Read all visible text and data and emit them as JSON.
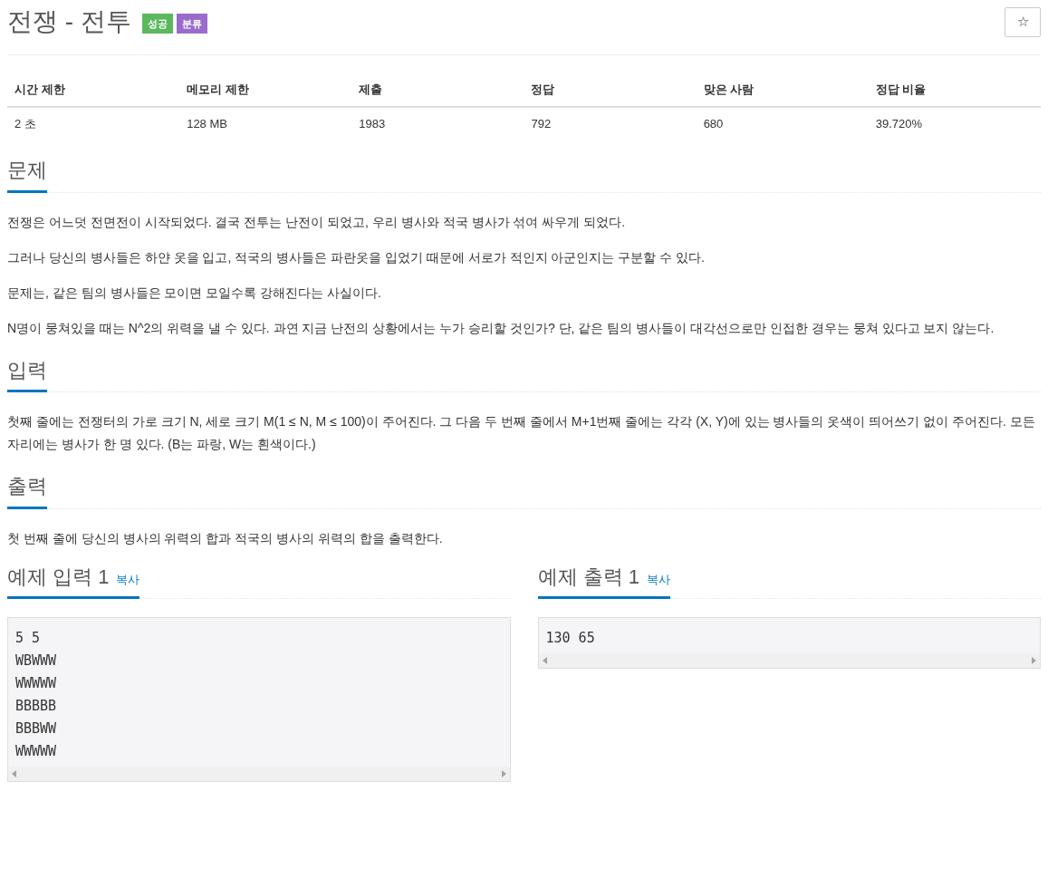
{
  "title": "전쟁 - 전투",
  "badges": [
    {
      "label": "성공",
      "color": "#5cb85c"
    },
    {
      "label": "분류",
      "color": "#9b6bcc"
    }
  ],
  "star_button": "☆",
  "stats": {
    "columns": [
      "시간 제한",
      "메모리 제한",
      "제출",
      "정답",
      "맞은 사람",
      "정답 비율"
    ],
    "row": [
      "2 초",
      "128 MB",
      "1983",
      "792",
      "680",
      "39.720%"
    ]
  },
  "sections": [
    {
      "heading": "문제",
      "paragraphs": [
        "전쟁은 어느덧 전면전이 시작되었다. 결국 전투는 난전이 되었고, 우리 병사와 적국 병사가 섞여 싸우게 되었다.",
        "그러나 당신의 병사들은 하얀 옷을 입고, 적국의 병사들은 파란옷을 입었기 때문에 서로가 적인지 아군인지는 구분할 수 있다.",
        "문제는, 같은 팀의 병사들은 모이면 모일수록 강해진다는 사실이다.",
        "N명이 뭉쳐있을 때는 N^2의 위력을 낼 수 있다. 과연 지금 난전의 상황에서는 누가 승리할 것인가? 단, 같은 팀의 병사들이 대각선으로만 인접한 경우는 뭉쳐 있다고 보지 않는다."
      ]
    },
    {
      "heading": "입력",
      "paragraphs": [
        "첫째 줄에는 전쟁터의 가로 크기 N, 세로 크기 M(1 ≤ N, M ≤ 100)이 주어진다. 그 다음 두 번째 줄에서 M+1번째 줄에는 각각 (X, Y)에 있는 병사들의 옷색이 띄어쓰기 없이 주어진다. 모든 자리에는 병사가 한 명 있다. (B는 파랑, W는 흰색이다.)"
      ]
    },
    {
      "heading": "출력",
      "paragraphs": [
        "첫 번째 줄에 당신의 병사의 위력의 합과 적국의 병사의 위력의 합을 출력한다."
      ]
    }
  ],
  "samples": [
    {
      "heading": "예제 입력 1",
      "copy": "복사",
      "code": "5 5\nWBWWW\nWWWWW\nBBBBB\nBBBWW\nWWWWW"
    },
    {
      "heading": "예제 출력 1",
      "copy": "복사",
      "code": "130 65"
    }
  ]
}
